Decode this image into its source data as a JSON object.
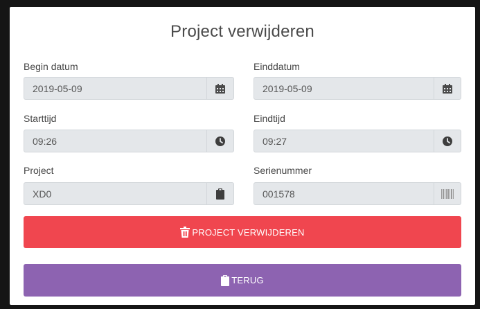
{
  "title": "Project verwijderen",
  "fields": {
    "begin_datum": {
      "label": "Begin datum",
      "value": "2019-05-09",
      "icon": "calendar-icon"
    },
    "einddatum": {
      "label": "Einddatum",
      "value": "2019-05-09",
      "icon": "calendar-icon"
    },
    "starttijd": {
      "label": "Starttijd",
      "value": "09:26",
      "icon": "clock-icon"
    },
    "eindtijd": {
      "label": "Eindtijd",
      "value": "09:27",
      "icon": "clock-icon"
    },
    "project": {
      "label": "Project",
      "value": "XD0",
      "icon": "clipboard-icon"
    },
    "serienummer": {
      "label": "Serienummer",
      "value": "001578",
      "icon": "barcode-icon"
    }
  },
  "buttons": {
    "delete_label": "PROJECT VERWIJDEREN",
    "back_label": "TERUG"
  },
  "colors": {
    "delete": "#f0464f",
    "back": "#8d63b1",
    "field_bg": "#e4e7ea",
    "icon_dark": "#4a4a4a"
  }
}
